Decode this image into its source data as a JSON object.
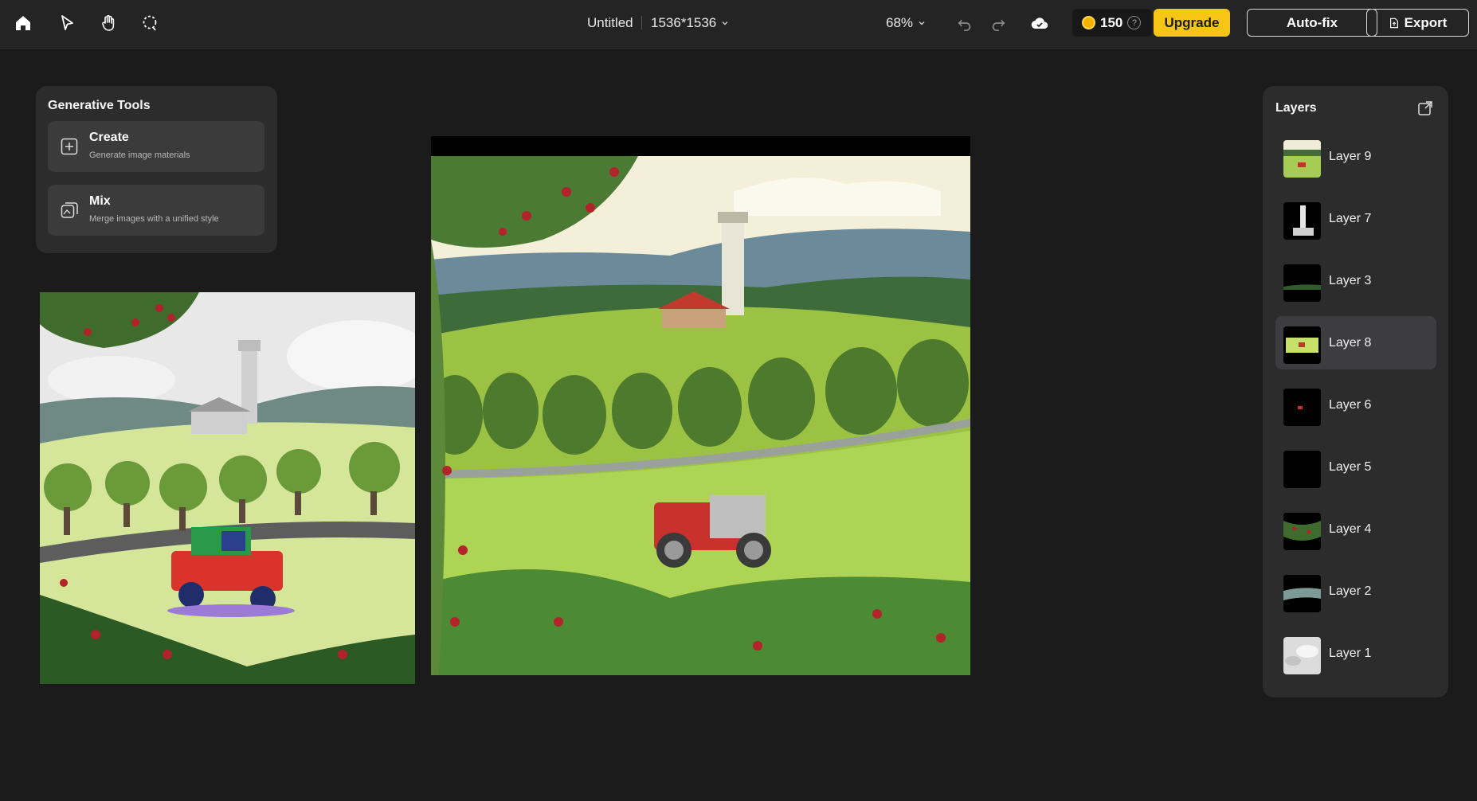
{
  "topbar": {
    "title": "Untitled",
    "size": "1536*1536",
    "zoom": "68%",
    "credits": "150",
    "help": "?",
    "upgrade_label": "Upgrade",
    "autofix_label": "Auto-fix",
    "export_label": "Export"
  },
  "generative_tools": {
    "title": "Generative Tools",
    "items": [
      {
        "title": "Create",
        "subtitle": "Generate image materials",
        "icon": "plus-square-icon"
      },
      {
        "title": "Mix",
        "subtitle": "Merge images with a unified style",
        "icon": "mix-images-icon"
      }
    ]
  },
  "layers": {
    "title": "Layers",
    "items": [
      {
        "name": "Layer 9",
        "selected": false
      },
      {
        "name": "Layer 7",
        "selected": false
      },
      {
        "name": "Layer 3",
        "selected": false
      },
      {
        "name": "Layer 8",
        "selected": true
      },
      {
        "name": "Layer 6",
        "selected": false
      },
      {
        "name": "Layer 5",
        "selected": false
      },
      {
        "name": "Layer 4",
        "selected": false
      },
      {
        "name": "Layer 2",
        "selected": false
      },
      {
        "name": "Layer 1",
        "selected": false
      }
    ]
  },
  "colors": {
    "accent": "#f6c515",
    "background": "#1b1b1b",
    "panel": "#2c2c2c"
  }
}
